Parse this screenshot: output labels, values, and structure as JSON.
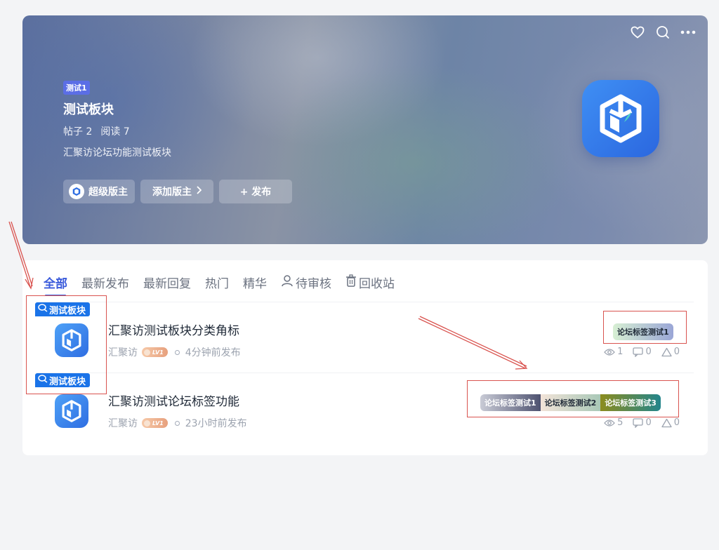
{
  "banner": {
    "badge": "测试1",
    "title": "测试板块",
    "posts_label": "帖子 2",
    "reads_label": "阅读 7",
    "description": "汇聚访论坛功能测试板块",
    "moderator_label": "超级版主",
    "add_moderator_label": "添加版主",
    "publish_label": "+ 发布",
    "icons": [
      "heart-icon",
      "search-icon",
      "more-icon"
    ]
  },
  "tabs": [
    {
      "label": "全部",
      "active": true
    },
    {
      "label": "最新发布"
    },
    {
      "label": "最新回复"
    },
    {
      "label": "热门"
    },
    {
      "label": "精华"
    },
    {
      "label": "待审核",
      "icon": "user-icon"
    },
    {
      "label": "回收站",
      "icon": "trash-icon"
    }
  ],
  "posts": [
    {
      "corner_label": "测试板块",
      "title": "汇聚访测试板块分类角标",
      "author": "汇聚访",
      "level": "LV1",
      "time": "4分钟前发布",
      "views": "1",
      "comments": "0",
      "likes": "0",
      "tags": [
        "论坛标签测试1"
      ]
    },
    {
      "corner_label": "测试板块",
      "title": "汇聚访测试论坛标签功能",
      "author": "汇聚访",
      "level": "LV1",
      "time": "23小时前发布",
      "views": "5",
      "comments": "0",
      "likes": "0",
      "tags": [
        "论坛标签测试1",
        "论坛标签测试2",
        "论坛标签测试3"
      ]
    }
  ],
  "colors": {
    "accent": "#3b5bdb",
    "corner_label_bg": "#1a73e8",
    "annotation": "#d9534f"
  }
}
